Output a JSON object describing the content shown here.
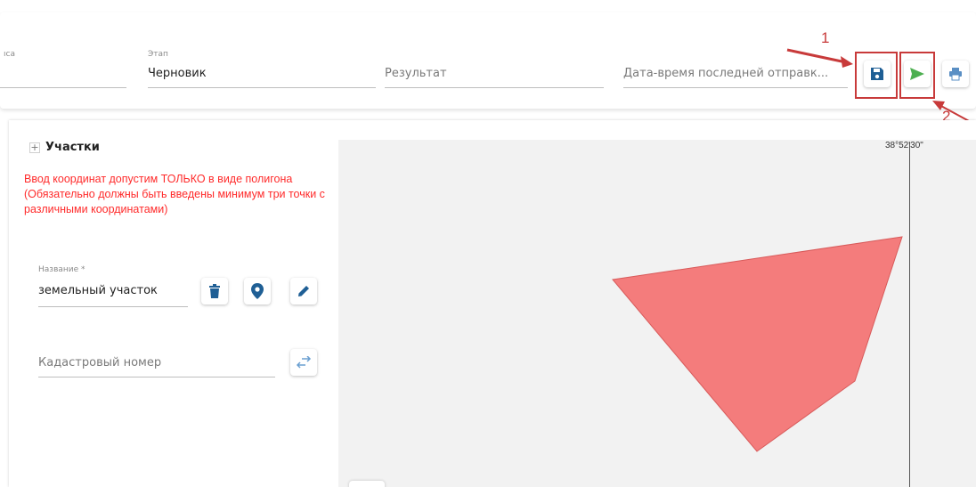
{
  "header": {
    "partial_label": "ıса",
    "stage": {
      "label": "Этап",
      "value": "Черновик"
    },
    "result": {
      "placeholder": "Результат"
    },
    "last_sent": {
      "placeholder": "Дата-время последней отправк..."
    }
  },
  "toolbar": {
    "save_icon": "floppy-disk-icon",
    "send_icon": "paper-plane-icon",
    "print_icon": "printer-icon",
    "accent_color": "#1f5f95",
    "send_color": "#4caf50"
  },
  "annotations": {
    "n1": "1",
    "n2": "2",
    "color": "#c83a3a"
  },
  "section": {
    "title": "Участки",
    "warning": "Ввод координат допустим ТОЛЬКО в виде полигона (Обязательно должны быть введены минимум три точки с различными координатами)",
    "warning_color": "#ff2b2b"
  },
  "plot": {
    "name_label": "Название *",
    "name_value": "земельный участок",
    "cadastral_placeholder": "Кадастровый номер"
  },
  "map": {
    "longitude_label": "38°52'30\"",
    "polygon_color": "#f47c7c"
  }
}
